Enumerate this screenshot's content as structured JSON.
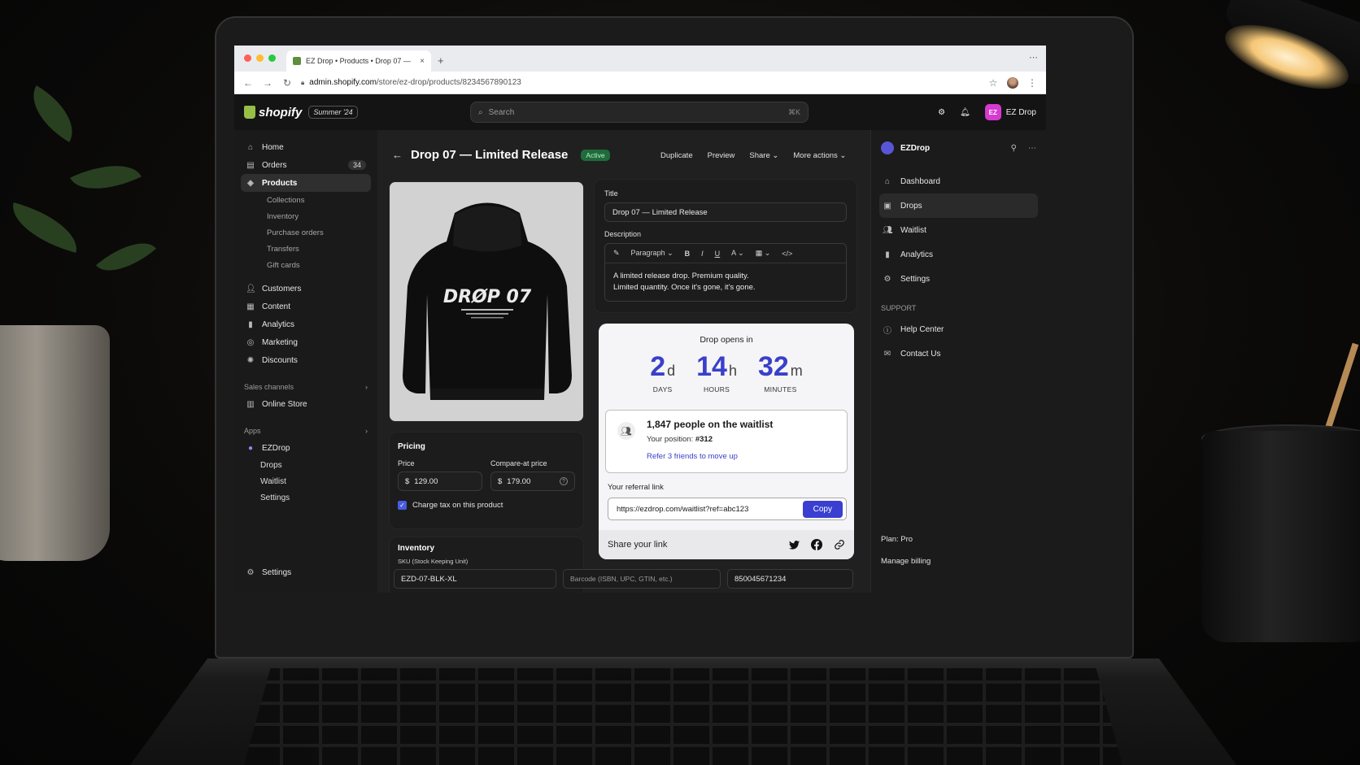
{
  "browser": {
    "tab_title": "EZ Drop • Products • Drop 07 —",
    "tab_close": "×",
    "new_tab": "+",
    "url_host": "admin.shopify.com",
    "url_path": "/store/ez-drop/products/8234567890123"
  },
  "topbar": {
    "logo_text": "shopify",
    "season_badge": "Summer '24",
    "search_placeholder": "Search",
    "search_shortcut": "⌘K",
    "store_initials": "EZ",
    "store_name": "EZ Drop"
  },
  "sidebar": {
    "home": "Home",
    "orders": "Orders",
    "orders_count": "34",
    "products": "Products",
    "products_sub": [
      "Collections",
      "Inventory",
      "Purchase orders",
      "Transfers",
      "Gift cards"
    ],
    "customers": "Customers",
    "content": "Content",
    "analytics": "Analytics",
    "marketing": "Marketing",
    "discounts": "Discounts",
    "sales_channels": "Sales channels",
    "online_store": "Online Store",
    "apps": "Apps",
    "ezdrop": "EZDrop",
    "ezdrop_sub": [
      "Drops",
      "Waitlist",
      "Settings"
    ],
    "settings": "Settings"
  },
  "page": {
    "title": "Drop 07 — Limited Release",
    "status": "Active",
    "actions": [
      "Duplicate",
      "Preview",
      "Share",
      "More actions"
    ]
  },
  "product_image": {
    "print_text": "DRØP 07"
  },
  "form": {
    "title_label": "Title",
    "title_value": "Drop 07 — Limited Release",
    "description_label": "Description",
    "paragraph_select": "Paragraph",
    "description_line1": "A limited release drop. Premium quality.",
    "description_line2": "Limited quantity. Once it's gone, it's gone."
  },
  "countdown": {
    "title": "Drop opens in",
    "days": "2",
    "days_suffix": "d",
    "days_caption": "DAYS",
    "hours": "14",
    "hours_suffix": "h",
    "hours_caption": "HOURS",
    "minutes": "32",
    "minutes_suffix": "m",
    "minutes_caption": "MINUTES",
    "waitlist_title": "1,847 people on the waitlist",
    "position_label": "Your position:",
    "position_value": "#312",
    "refer_link": "Refer 3 friends to move up",
    "referral_label": "Your referral link",
    "referral_url": "https://ezdrop.com/waitlist?ref=abc123",
    "copy_label": "Copy",
    "share_label": "Share your link"
  },
  "pricing": {
    "heading": "Pricing",
    "price_label": "Price",
    "price_currency": "$",
    "price_value": "129.00",
    "compare_label": "Compare-at price",
    "compare_currency": "$",
    "compare_value": "179.00",
    "charge_tax_label": "Charge tax on this product",
    "charge_tax_checked": true
  },
  "inventory": {
    "heading": "Inventory",
    "sku_label": "SKU (Stock Keeping Unit)",
    "sku_value": "EZD-07-BLK-XL",
    "barcode_placeholder": "Barcode (ISBN, UPC, GTIN, etc.)",
    "barcode_value": "850045671234"
  },
  "right_panel": {
    "app_name": "EZDrop",
    "nav": [
      "Dashboard",
      "Drops",
      "Waitlist",
      "Analytics",
      "Settings"
    ],
    "support_heading": "SUPPORT",
    "support": [
      "Help Center",
      "Contact Us"
    ],
    "plan": "Plan: Pro",
    "billing": "Manage billing"
  },
  "colors": {
    "accent": "#3a40c9",
    "active_badge": "#1f6b3a",
    "shopify_green": "#95bf47"
  }
}
